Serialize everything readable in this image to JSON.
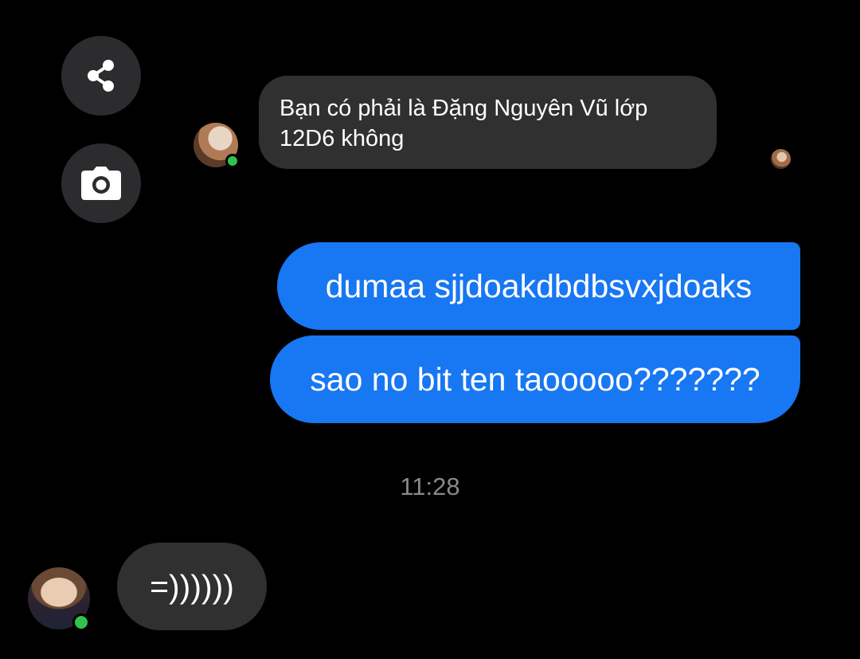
{
  "actions": {
    "share_icon": "share-icon",
    "camera_icon": "camera-icon"
  },
  "messages": [
    {
      "direction": "incoming",
      "text": "Bạn có phải là Đặng Nguyên Vũ lớp\n12D6 không"
    },
    {
      "direction": "outgoing",
      "text": "dumaa sjjdoakdbdbsvxjdoaks"
    },
    {
      "direction": "outgoing",
      "text": "sao no bit ten taooooo???????"
    },
    {
      "direction": "incoming",
      "text": "=))))))"
    }
  ],
  "timestamp": "11:28",
  "colors": {
    "background": "#000000",
    "incoming_bubble": "#303030",
    "outgoing_bubble": "#1877f2",
    "online": "#31c24d",
    "timestamp": "#8a8a8a"
  }
}
